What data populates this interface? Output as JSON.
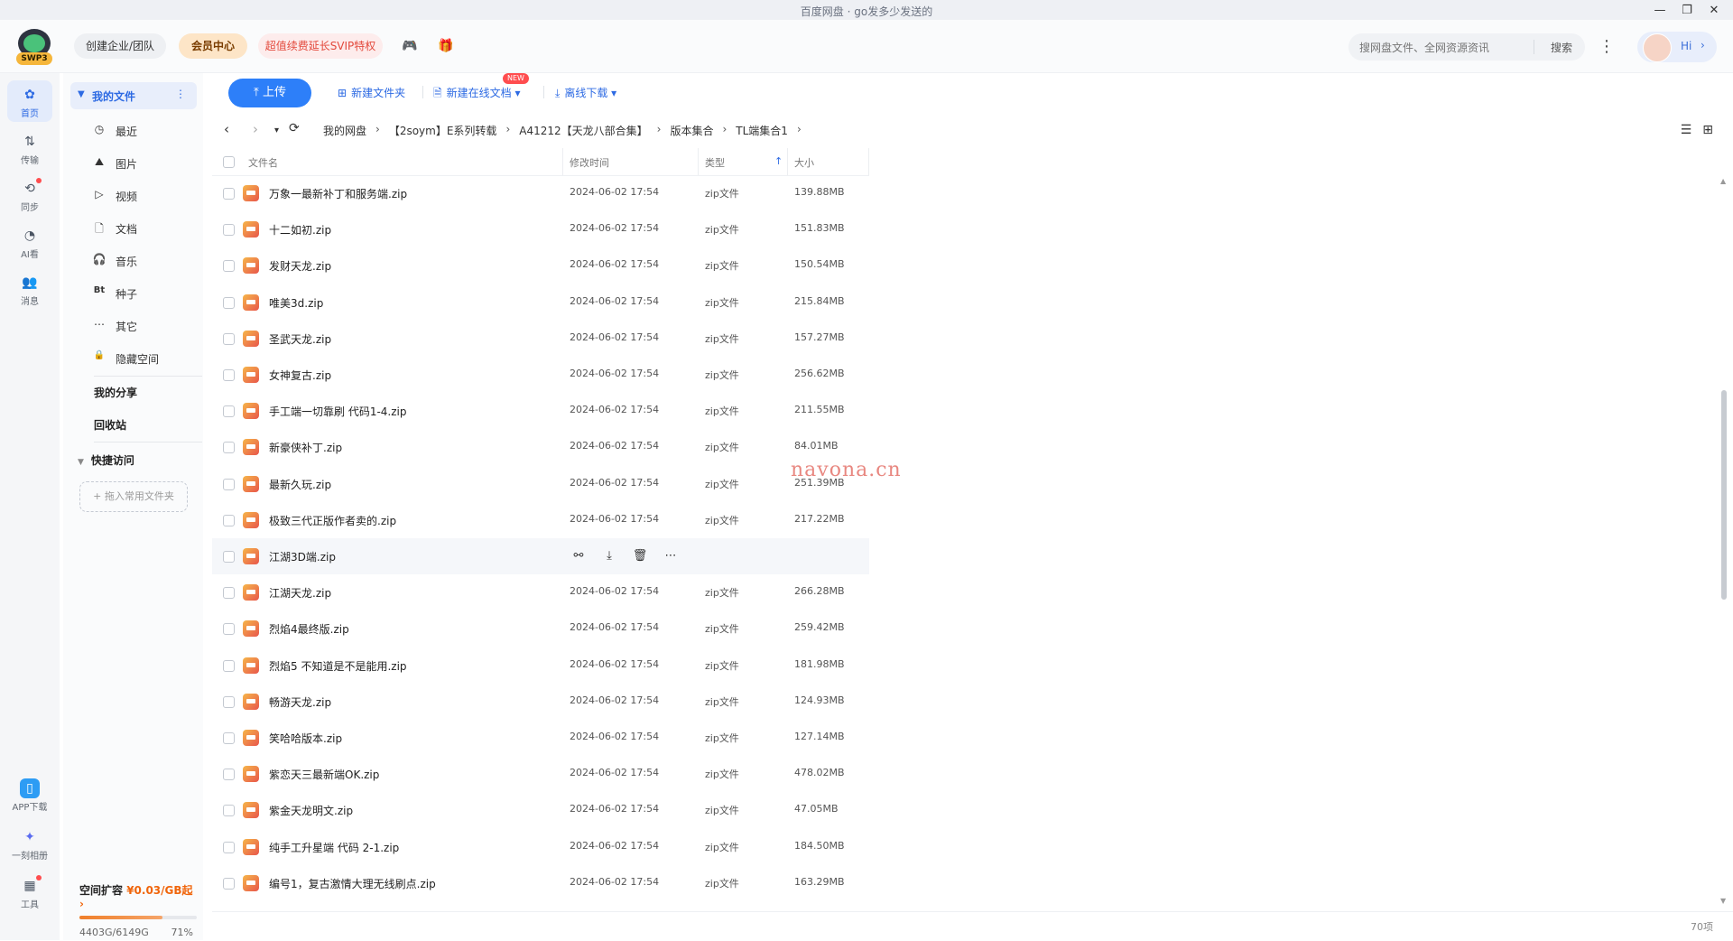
{
  "window": {
    "title": "百度网盘 · go发多少发送的"
  },
  "logo": {
    "badge": "SWP3"
  },
  "header": {
    "team_label": "创建企业/团队",
    "vip_label": "会员中心",
    "svip_label": "超值续费延长SVIP特权",
    "search_placeholder": "搜网盘文件、全网资源资讯",
    "search_button": "搜索",
    "greeting": "Hi"
  },
  "rail": [
    {
      "label": "首页",
      "icon": "home-icon"
    },
    {
      "label": "传输",
      "icon": "transfer-icon"
    },
    {
      "label": "同步",
      "icon": "sync-icon"
    },
    {
      "label": "AI看",
      "icon": "ai-icon"
    },
    {
      "label": "消息",
      "icon": "message-icon"
    },
    {
      "label": "APP下载",
      "icon": "app-icon"
    },
    {
      "label": "一刻相册",
      "icon": "album-icon"
    },
    {
      "label": "工具",
      "icon": "tools-icon"
    }
  ],
  "sidebar": {
    "my_files": "我的文件",
    "items": [
      {
        "label": "最近",
        "glyph": "◷"
      },
      {
        "label": "图片",
        "glyph": "⛰"
      },
      {
        "label": "视频",
        "glyph": "▷"
      },
      {
        "label": "文档",
        "glyph": "🗋"
      },
      {
        "label": "音乐",
        "glyph": "🎧"
      },
      {
        "label": "种子",
        "glyph": "Bt"
      },
      {
        "label": "其它",
        "glyph": "⋯"
      },
      {
        "label": "隐藏空间",
        "glyph": "🔒"
      }
    ],
    "my_share": "我的分享",
    "recycle": "回收站",
    "quick_access": "快捷访问",
    "drop_hint": "+ 拖入常用文件夹",
    "space_title": "空间扩容",
    "space_price": "¥0.03/GB起",
    "space_used": "4403G/6149G",
    "space_percent": "71%",
    "space_fraction": 0.71
  },
  "toolbar": {
    "upload": "上传",
    "new_folder": "新建文件夹",
    "new_doc": "新建在线文档",
    "new_badge": "NEW",
    "offline": "离线下载"
  },
  "breadcrumbs": [
    "我的网盘",
    "【2soym】E系列转载",
    "A41212【天龙八部合集】",
    "版本集合",
    "TL端集合1"
  ],
  "table": {
    "headers": {
      "name": "文件名",
      "modified": "修改时间",
      "type": "类型",
      "size": "大小"
    },
    "rows": [
      {
        "name": "万象一最新补丁和服务端.zip",
        "date": "2024-06-02 17:54",
        "type": "zip文件",
        "size": "139.88MB"
      },
      {
        "name": "十二如初.zip",
        "date": "2024-06-02 17:54",
        "type": "zip文件",
        "size": "151.83MB"
      },
      {
        "name": "发财天龙.zip",
        "date": "2024-06-02 17:54",
        "type": "zip文件",
        "size": "150.54MB"
      },
      {
        "name": "唯美3d.zip",
        "date": "2024-06-02 17:54",
        "type": "zip文件",
        "size": "215.84MB"
      },
      {
        "name": "圣武天龙.zip",
        "date": "2024-06-02 17:54",
        "type": "zip文件",
        "size": "157.27MB"
      },
      {
        "name": "女神复古.zip",
        "date": "2024-06-02 17:54",
        "type": "zip文件",
        "size": "256.62MB"
      },
      {
        "name": "手工端一切靠刷 代码1-4.zip",
        "date": "2024-06-02 17:54",
        "type": "zip文件",
        "size": "211.55MB"
      },
      {
        "name": "新豪侠补丁.zip",
        "date": "2024-06-02 17:54",
        "type": "zip文件",
        "size": "84.01MB"
      },
      {
        "name": "最新久玩.zip",
        "date": "2024-06-02 17:54",
        "type": "zip文件",
        "size": "251.39MB"
      },
      {
        "name": "极致三代正版作者卖的.zip",
        "date": "2024-06-02 17:54",
        "type": "zip文件",
        "size": "217.22MB"
      },
      {
        "name": "江湖3D端.zip",
        "date": "",
        "type": "",
        "size": "",
        "hover": true
      },
      {
        "name": "江湖天龙.zip",
        "date": "2024-06-02 17:54",
        "type": "zip文件",
        "size": "266.28MB"
      },
      {
        "name": "烈焰4最终版.zip",
        "date": "2024-06-02 17:54",
        "type": "zip文件",
        "size": "259.42MB"
      },
      {
        "name": "烈焰5 不知道是不是能用.zip",
        "date": "2024-06-02 17:54",
        "type": "zip文件",
        "size": "181.98MB"
      },
      {
        "name": "畅游天龙.zip",
        "date": "2024-06-02 17:54",
        "type": "zip文件",
        "size": "124.93MB"
      },
      {
        "name": "笑哈哈版本.zip",
        "date": "2024-06-02 17:54",
        "type": "zip文件",
        "size": "127.14MB"
      },
      {
        "name": "紫恋天三最新端OK.zip",
        "date": "2024-06-02 17:54",
        "type": "zip文件",
        "size": "478.02MB"
      },
      {
        "name": "紫金天龙明文.zip",
        "date": "2024-06-02 17:54",
        "type": "zip文件",
        "size": "47.05MB"
      },
      {
        "name": "纯手工升星端 代码 2-1.zip",
        "date": "2024-06-02 17:54",
        "type": "zip文件",
        "size": "184.50MB"
      },
      {
        "name": "编号1，复古激情大理无线刷点.zip",
        "date": "2024-06-02 17:54",
        "type": "zip文件",
        "size": "163.29MB"
      }
    ],
    "total": "70项"
  },
  "watermark": "navona.cn",
  "colors": {
    "accent": "#2d7ff9",
    "vip": "#7a3d00",
    "svip": "#e3493c",
    "price": "#f0650b"
  }
}
